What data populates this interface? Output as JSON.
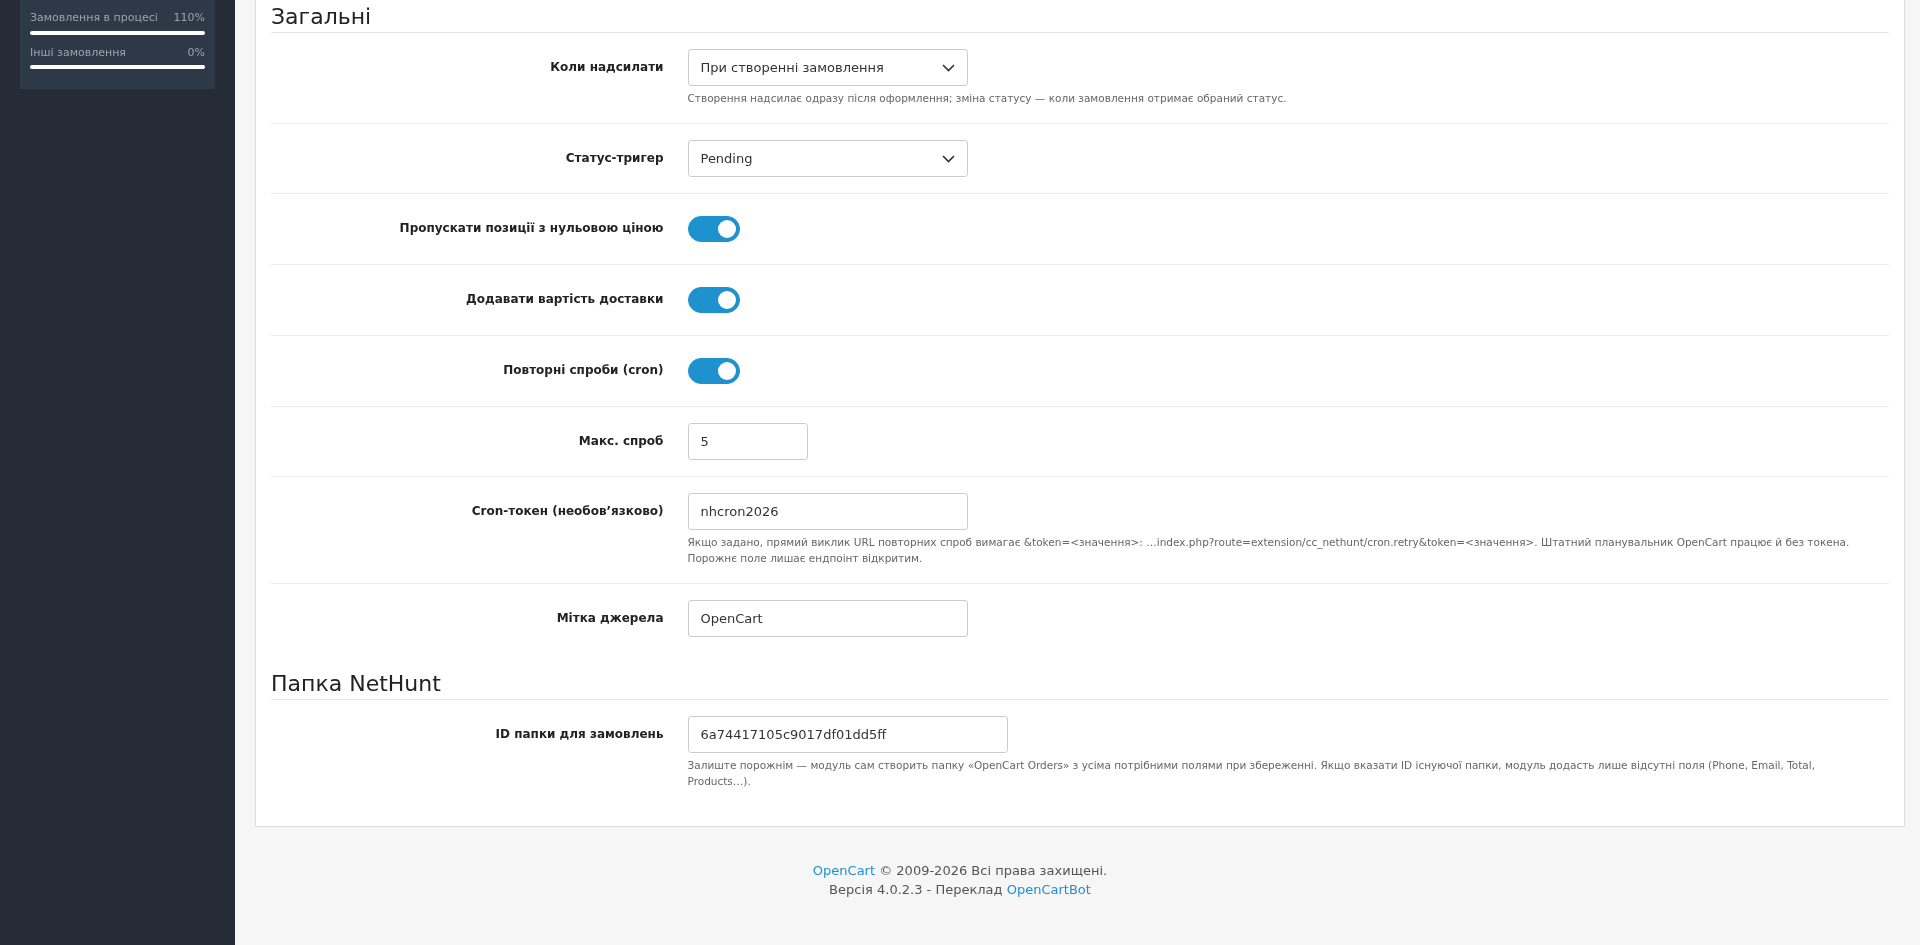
{
  "sidebar": {
    "stats": [
      {
        "label": "Замовлення в процесі",
        "value": "110%"
      },
      {
        "label": "Інші замовлення",
        "value": "0%"
      }
    ]
  },
  "sections": [
    {
      "title": "Загальні",
      "fields": [
        {
          "kind": "select",
          "label": "Коли надсилати",
          "value": "При створенні замовлення",
          "help": "Створення надсилає одразу після оформлення; зміна статусу — коли замовлення отримає обраний статус."
        },
        {
          "kind": "select",
          "label": "Статус-тригер",
          "value": "Pending"
        },
        {
          "kind": "switch",
          "label": "Пропускати позиції з нульовою ціною",
          "on": true
        },
        {
          "kind": "switch",
          "label": "Додавати вартість доставки",
          "on": true
        },
        {
          "kind": "switch",
          "label": "Повторні спроби (cron)",
          "on": true
        },
        {
          "kind": "number",
          "label": "Макс. спроб",
          "value": "5"
        },
        {
          "kind": "input",
          "label": "Cron-токен (необов’язково)",
          "value": "nhcron2026",
          "help": "Якщо задано, прямий виклик URL повторних спроб вимагає &token=<значення>: …index.php?route=extension/cc_nethunt/cron.retry&token=<значення>. Штатний планувальник OpenCart працює й без токена. Порожнє поле лишає ендпоінт відкритим."
        },
        {
          "kind": "input",
          "label": "Мітка джерела",
          "value": "OpenCart"
        }
      ]
    },
    {
      "title": "Папка NetHunt",
      "fields": [
        {
          "kind": "identifier",
          "label": "ID папки для замовлень",
          "value": "6a74417105c9017df01dd5ff",
          "help": "Залиште порожнім — модуль сам створить папку «OpenCart Orders» з усіма потрібними полями при збереженні. Якщо вказати ID існуючої папки, модуль додасть лише відсутні поля (Phone, Email, Total, Products…)."
        }
      ]
    }
  ],
  "footer": {
    "line_1": [
      {
        "kind": "link",
        "text": "OpenCart"
      },
      {
        "kind": "text",
        "text": " © 2009-2026 Всі права захищені."
      }
    ],
    "line_2": [
      {
        "kind": "text",
        "text": "Версія 4.0.2.3 - Переклад "
      },
      {
        "kind": "link",
        "text": "OpenCartBot"
      }
    ]
  }
}
